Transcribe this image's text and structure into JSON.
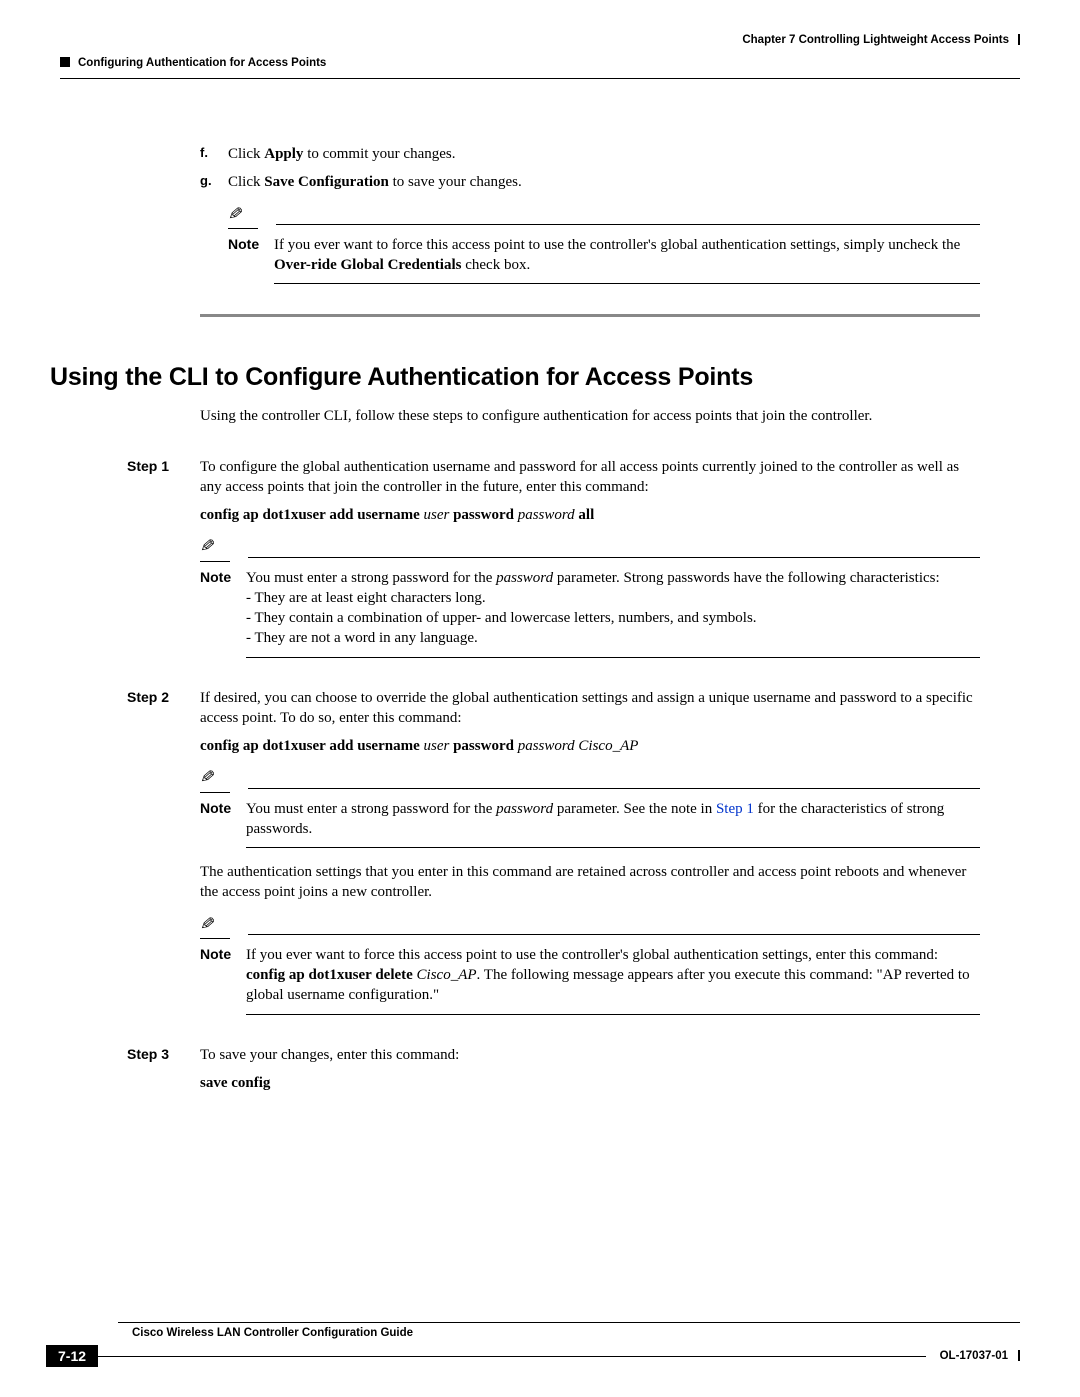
{
  "header": {
    "chapter_line": "Chapter 7     Controlling Lightweight Access Points",
    "section_line": "Configuring Authentication for Access Points"
  },
  "items": {
    "f_marker": "f.",
    "f_pre": "Click ",
    "f_bold": "Apply",
    "f_post": " to commit your changes.",
    "g_marker": "g.",
    "g_pre": "Click ",
    "g_bold": "Save Configuration",
    "g_post": " to save your changes."
  },
  "note_g": {
    "label": "Note",
    "t1": "If you ever want to force this access point to use the controller's global authentication settings, simply uncheck the ",
    "t2_bold": "Over-ride Global Credentials",
    "t3": " check box."
  },
  "h1": "Using the CLI to Configure Authentication for Access Points",
  "intro": "Using the controller CLI, follow these steps to configure authentication for access points that join the controller.",
  "step1": {
    "label": "Step 1",
    "body": "To configure the global authentication username and password for all access points currently joined to the controller as well as any access points that join the controller in the future, enter this command:",
    "cmd_b1": "config ap dot1xuser add username",
    "cmd_i1": "user",
    "cmd_b2": "password",
    "cmd_i2": "password",
    "cmd_b3": "all"
  },
  "note1": {
    "label": "Note",
    "p1": "You must enter a strong password for the ",
    "p2_i": "password",
    "p3": " parameter. Strong passwords have the following characteristics:",
    "b1": "- They are at least eight characters long.",
    "b2": "- They contain a combination of upper- and lowercase letters, numbers, and symbols.",
    "b3": "- They are not a word in any language."
  },
  "step2": {
    "label": "Step 2",
    "body": "If desired, you can choose to override the global authentication settings and assign a unique username and password to a specific access point. To do so, enter this command:",
    "cmd_b1": "config ap dot1xuser add username",
    "cmd_i1": "user",
    "cmd_b2": "password",
    "cmd_i2": "password Cisco_AP"
  },
  "note2": {
    "label": "Note",
    "p1": "You must enter a strong password for the ",
    "p2_i": "password",
    "p3": " parameter. See the note in ",
    "p4_link": "Step 1",
    "p5": " for the characteristics of strong passwords."
  },
  "reboot_para": "The authentication settings that you enter in this command are retained across controller and access point reboots and whenever the access point joins a new controller.",
  "note3": {
    "label": "Note",
    "p1": "If you ever want to force this access point to use the controller's global authentication settings, enter this command: ",
    "p2_b": "config ap dot1xuser delete",
    "p3_i": " Cisco_AP",
    "p4": ". The following message appears after you execute this command: \"AP reverted to global username configuration.\""
  },
  "step3": {
    "label": "Step 3",
    "body": "To save your changes, enter this command:",
    "cmd_b1": "save config"
  },
  "footer": {
    "guide": "Cisco Wireless LAN Controller Configuration Guide",
    "page": "7-12",
    "docid": "OL-17037-01"
  }
}
